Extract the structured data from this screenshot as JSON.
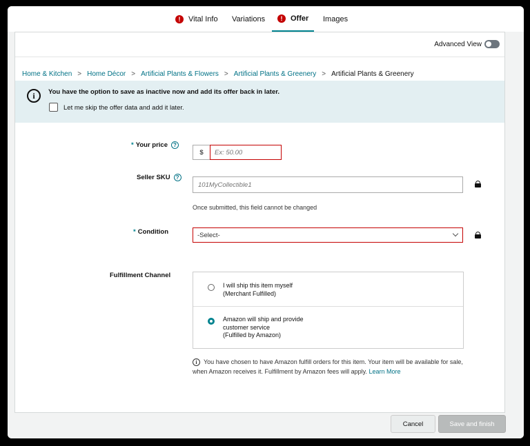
{
  "tabs": [
    {
      "label": "Vital Info",
      "warning": true
    },
    {
      "label": "Variations",
      "warning": false
    },
    {
      "label": "Offer",
      "warning": true,
      "active": true
    },
    {
      "label": "Images",
      "warning": false
    }
  ],
  "advanced_view": {
    "label": "Advanced View",
    "enabled": false
  },
  "breadcrumb": {
    "items": [
      "Home & Kitchen",
      "Home Décor",
      "Artificial Plants & Flowers",
      "Artificial Plants & Greenery"
    ],
    "current": "Artificial Plants & Greenery",
    "separator": ">"
  },
  "info_bar": {
    "icon_glyph": "i",
    "title": "You have the option to save as inactive now and add its offer back in later.",
    "checkbox_label": "Let me skip the offer data and add it later."
  },
  "form": {
    "price": {
      "required_mark": "*",
      "label": "Your price",
      "help": "?",
      "currency": "$",
      "placeholder": "Ex: 50.00"
    },
    "sku": {
      "label": "Seller SKU",
      "help": "?",
      "placeholder": "101MyCollectible1",
      "hint": "Once submitted, this field cannot be changed"
    },
    "condition": {
      "required_mark": "*",
      "label": "Condition",
      "selected": "-Select-"
    },
    "fulfillment": {
      "label": "Fulfillment Channel",
      "options": [
        {
          "line1": "I will ship this item myself",
          "line2": "(Merchant Fulfilled)",
          "line3": "",
          "selected": false
        },
        {
          "line1": "Amazon will ship and provide",
          "line2": "customer service",
          "line3": "(Fulfilled by Amazon)",
          "selected": true
        }
      ],
      "note": "You have chosen to have Amazon fulfill orders for this item. Your item will be available for sale, when Amazon receives it. Fulfillment by Amazon fees will apply.",
      "learn_more": "Learn More"
    }
  },
  "footer": {
    "cancel_label": "Cancel",
    "save_label": "Save and finish"
  },
  "colors": {
    "accent": "#00838f",
    "error": "#c40000",
    "link": "#007185"
  }
}
